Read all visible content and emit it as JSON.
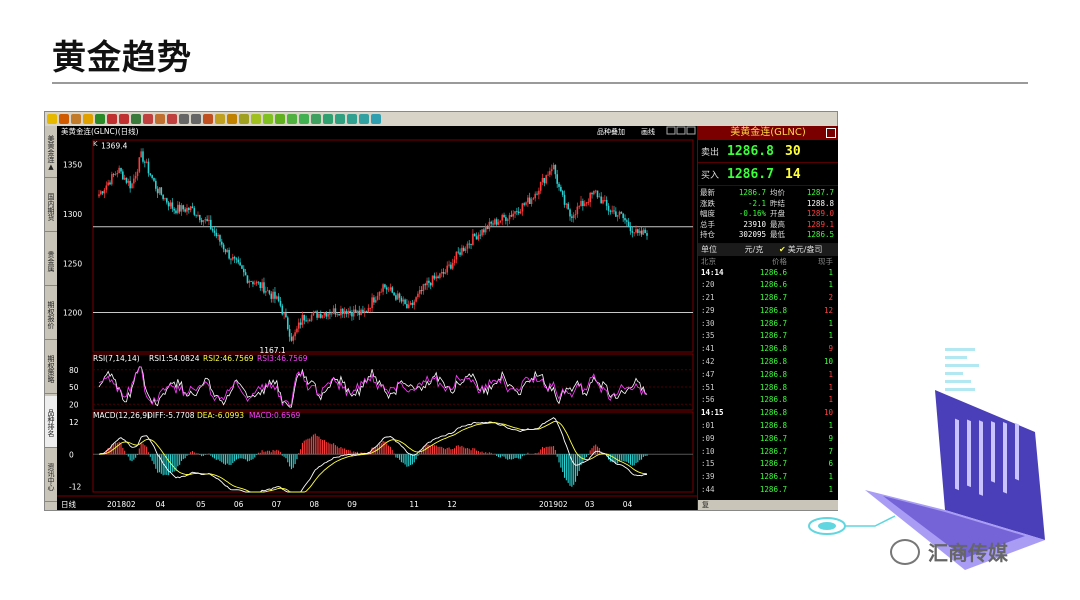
{
  "slide": {
    "title": "黄金趋势"
  },
  "chart_window": {
    "symbol_label": "美黄金连(GLNC)(日线)",
    "top_right_label": "品种叠加",
    "top_right_label2": "画线",
    "left_tabs": [
      "美黄金连▲",
      "国内期货",
      "贵金属",
      "期权报价",
      "期权策略",
      "品种排名",
      "资讯中心"
    ],
    "corner_marker": "K"
  },
  "price_panel": {
    "y_ticks": [
      1350,
      1300,
      1250,
      1200
    ],
    "ylim": [
      1160,
      1375
    ],
    "h_lines": [
      1287,
      1200
    ],
    "high_label": "1369.4",
    "low_label": "1167.1"
  },
  "rsi_panel": {
    "label": "RSI(7,14,14)",
    "rsi1": "RSI1:54.0824",
    "rsi2": "RSI2:46.7569",
    "rsi3": "RSI3:46.7569",
    "y_ticks": [
      80,
      50,
      20
    ],
    "colors": {
      "rsi1": "#ffffff",
      "rsi2": "#ffff40",
      "rsi3": "#ff40ff"
    }
  },
  "macd_panel": {
    "label": "MACD(12,26,9)",
    "diff": "DIFF:-5.7708",
    "dea": "DEA:-6.0993",
    "macd": "MACD:0.6569",
    "y_ticks": [
      12,
      0,
      -12
    ]
  },
  "x_axis": {
    "period": "日线",
    "labels": [
      "201802",
      "04",
      "05",
      "06",
      "07",
      "08",
      "09",
      "11",
      "12",
      "201902",
      "03",
      "04"
    ]
  },
  "quote": {
    "title": "美黄金连(GLNC)",
    "sell_label": "卖出",
    "sell_price": "1286.8",
    "sell_vol": "30",
    "buy_label": "买入",
    "buy_price": "1286.7",
    "buy_vol": "14",
    "stats": [
      [
        "最新",
        "1286.7",
        "g",
        "均价",
        "1287.7",
        "g"
      ],
      [
        "涨跌",
        "-2.1",
        "g",
        "昨结",
        "1288.8",
        "w"
      ],
      [
        "幅度",
        "-0.16%",
        "g",
        "开盘",
        "1289.0",
        "r"
      ],
      [
        "总手",
        "23910",
        "w",
        "最高",
        "1289.1",
        "r"
      ],
      [
        "持仓",
        "302095",
        "w",
        "最低",
        "1286.5",
        "g"
      ]
    ],
    "unit_label": "单位",
    "unit_value": "元/克",
    "unit_option": "美元/盎司",
    "col_headers": [
      "北京",
      "价格",
      "现手"
    ],
    "ticks": [
      [
        "14:14",
        "1286.6",
        "1",
        "g",
        true
      ],
      [
        ":20",
        "1286.6",
        "1",
        "g",
        false
      ],
      [
        ":21",
        "1286.7",
        "2",
        "r",
        false
      ],
      [
        ":29",
        "1286.8",
        "12",
        "r",
        false
      ],
      [
        ":30",
        "1286.7",
        "1",
        "g",
        false
      ],
      [
        ":35",
        "1286.7",
        "1",
        "g",
        false
      ],
      [
        ":41",
        "1286.8",
        "9",
        "r",
        false
      ],
      [
        ":42",
        "1286.8",
        "10",
        "g",
        false
      ],
      [
        ":47",
        "1286.8",
        "1",
        "r",
        false
      ],
      [
        ":51",
        "1286.8",
        "1",
        "r",
        false
      ],
      [
        ":56",
        "1286.8",
        "1",
        "r",
        false
      ],
      [
        "14:15",
        "1286.8",
        "10",
        "r",
        true
      ],
      [
        ":01",
        "1286.8",
        "1",
        "g",
        false
      ],
      [
        ":09",
        "1286.7",
        "9",
        "g",
        false
      ],
      [
        ":10",
        "1286.7",
        "7",
        "g",
        false
      ],
      [
        ":15",
        "1286.7",
        "6",
        "g",
        false
      ],
      [
        ":39",
        "1286.7",
        "1",
        "g",
        false
      ],
      [
        ":44",
        "1286.7",
        "1",
        "g",
        false
      ]
    ],
    "footer": "复"
  },
  "watermark": "汇商传媒",
  "colors": {
    "up": "#ff3b3b",
    "down": "#27d3d3",
    "grid": "#7a0000",
    "ma": "#ffff40"
  }
}
